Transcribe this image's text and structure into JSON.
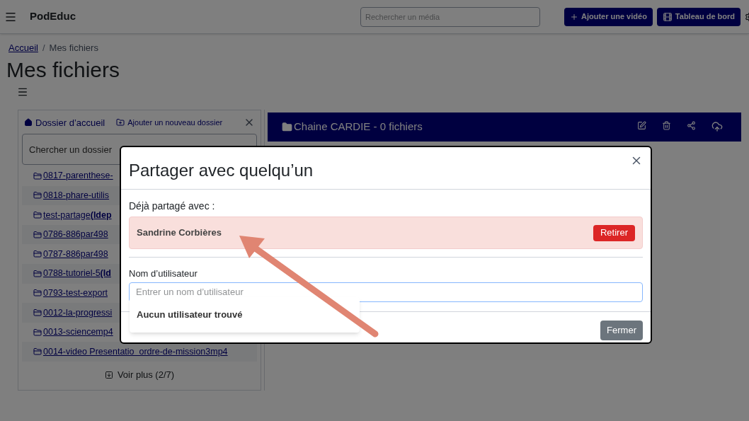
{
  "header": {
    "app_name": "PodEduc",
    "search": {
      "placeholder": "Rechercher un média"
    },
    "buttons": [
      {
        "label": "Ajouter une vidéo",
        "kind": "add"
      },
      {
        "label": "Tableau de bord",
        "kind": "dashboard"
      }
    ]
  },
  "breadcrumb": {
    "separator": "/",
    "items": [
      {
        "label": "Accueil",
        "link": true
      },
      {
        "label": "Mes fichiers",
        "link": false
      }
    ]
  },
  "page_title": "Mes fichiers",
  "folder_panel": {
    "home": "Dossier d’accueil",
    "add_folder": "Ajouter un nouveau dossier",
    "search": {
      "placeholder": "Chercher un dossier"
    },
    "folders": [
      "0817-parenthese-",
      "0818-phare-utilis",
      "test-partage**(Idep**",
      "0786-886par498",
      "0787-886par498",
      "0788-tutoriel-5**(Id**",
      "0793-test-export",
      "0012-la-progressi",
      "0013-sciencemp4",
      "0014-video Presentatio  ordre-de-mission3mp4"
    ],
    "more": "Voir plus (2/7)"
  },
  "current_folder": {
    "title": "Chaine CARDIE - 0 fichiers"
  },
  "modal": {
    "title": "Partager avec quelqu’un",
    "shared_label": "Déjà partagé avec :",
    "shared_users": [
      {
        "name": "Sandrine Corbières",
        "action": "Retirer"
      }
    ],
    "username_label": "Nom d’utilisateur",
    "username_field": {
      "placeholder": "Entrer un nom d’utilisateur"
    },
    "suggestion": "Aucun utilisateur trouvé",
    "close_button": "Fermer"
  }
}
